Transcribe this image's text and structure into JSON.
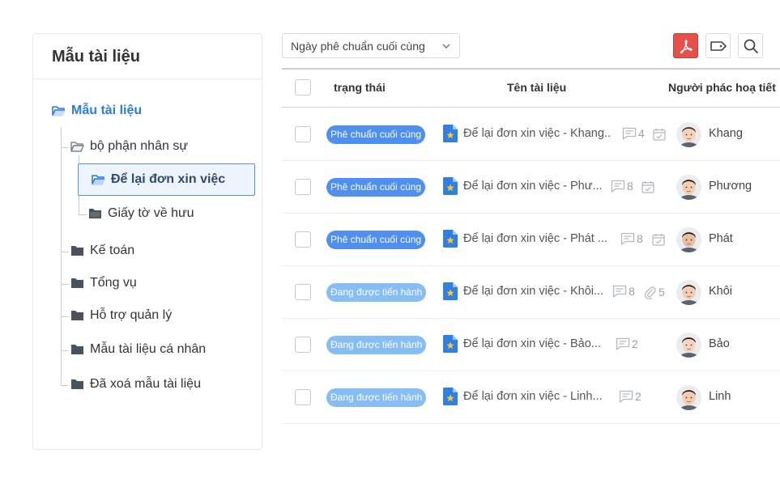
{
  "sidebar": {
    "title": "Mẫu tài liệu",
    "tree": {
      "root": "Mẫu tài liệu",
      "hr": "bộ phận nhân sự",
      "resignation": "Để lại đơn xin việc",
      "retirement": "Giấy tờ về hưu",
      "accounting": "Kế toán",
      "general": "Tổng vụ",
      "admin_support": "Hỗ trợ quản lý",
      "personal": "Mẫu tài liệu cá nhân",
      "deleted": "Đã xoá mẫu tài liệu"
    }
  },
  "toolbar": {
    "sort_label": "Ngày phê chuẩn cuối cùng",
    "icons": [
      "chevron-down-icon",
      "pdf-icon",
      "tag-icon",
      "search-icon"
    ]
  },
  "table": {
    "headers": {
      "status": "trạng thái",
      "name": "Tên tài liệu",
      "drafter": "Người phác hoạ tiết"
    },
    "rows": [
      {
        "status": "Phê chuẩn cuối cùng",
        "status_kind": "final",
        "name": "Để lại đơn xin việc - Khang..",
        "comments": "4",
        "extra_icon": "calendar-check-icon",
        "extra_value": "",
        "author": "Khang"
      },
      {
        "status": "Phê chuẩn cuối cùng",
        "status_kind": "final",
        "name": "Để lại đơn xin việc - Phư...",
        "comments": "8",
        "extra_icon": "calendar-check-icon",
        "extra_value": "",
        "author": "Phương"
      },
      {
        "status": "Phê chuẩn cuối cùng",
        "status_kind": "final",
        "name": "Để lại đơn xin việc - Phát ...",
        "comments": "8",
        "extra_icon": "calendar-check-icon",
        "extra_value": "",
        "author": "Phát"
      },
      {
        "status": "Đang được tiến hành",
        "status_kind": "progress",
        "name": "Để lại đơn xin việc - Khôi...",
        "comments": "8",
        "extra_icon": "paperclip-icon",
        "extra_value": "5",
        "author": "Khôi"
      },
      {
        "status": "Đang được tiến hành",
        "status_kind": "progress",
        "name": "Để lại đơn xin việc - Bảo...",
        "comments": "2",
        "extra_icon": "",
        "extra_value": "",
        "author": "Bảo"
      },
      {
        "status": "Đang được tiến hành",
        "status_kind": "progress",
        "name": "Để lại đơn xin việc - Linh...",
        "comments": "2",
        "extra_icon": "",
        "extra_value": "",
        "author": "Linh"
      }
    ]
  },
  "colors": {
    "accent": "#2c7be5",
    "badge_final": "#4e8fef",
    "badge_progress": "#86bdf5",
    "pdf_button": "#e5504a"
  }
}
